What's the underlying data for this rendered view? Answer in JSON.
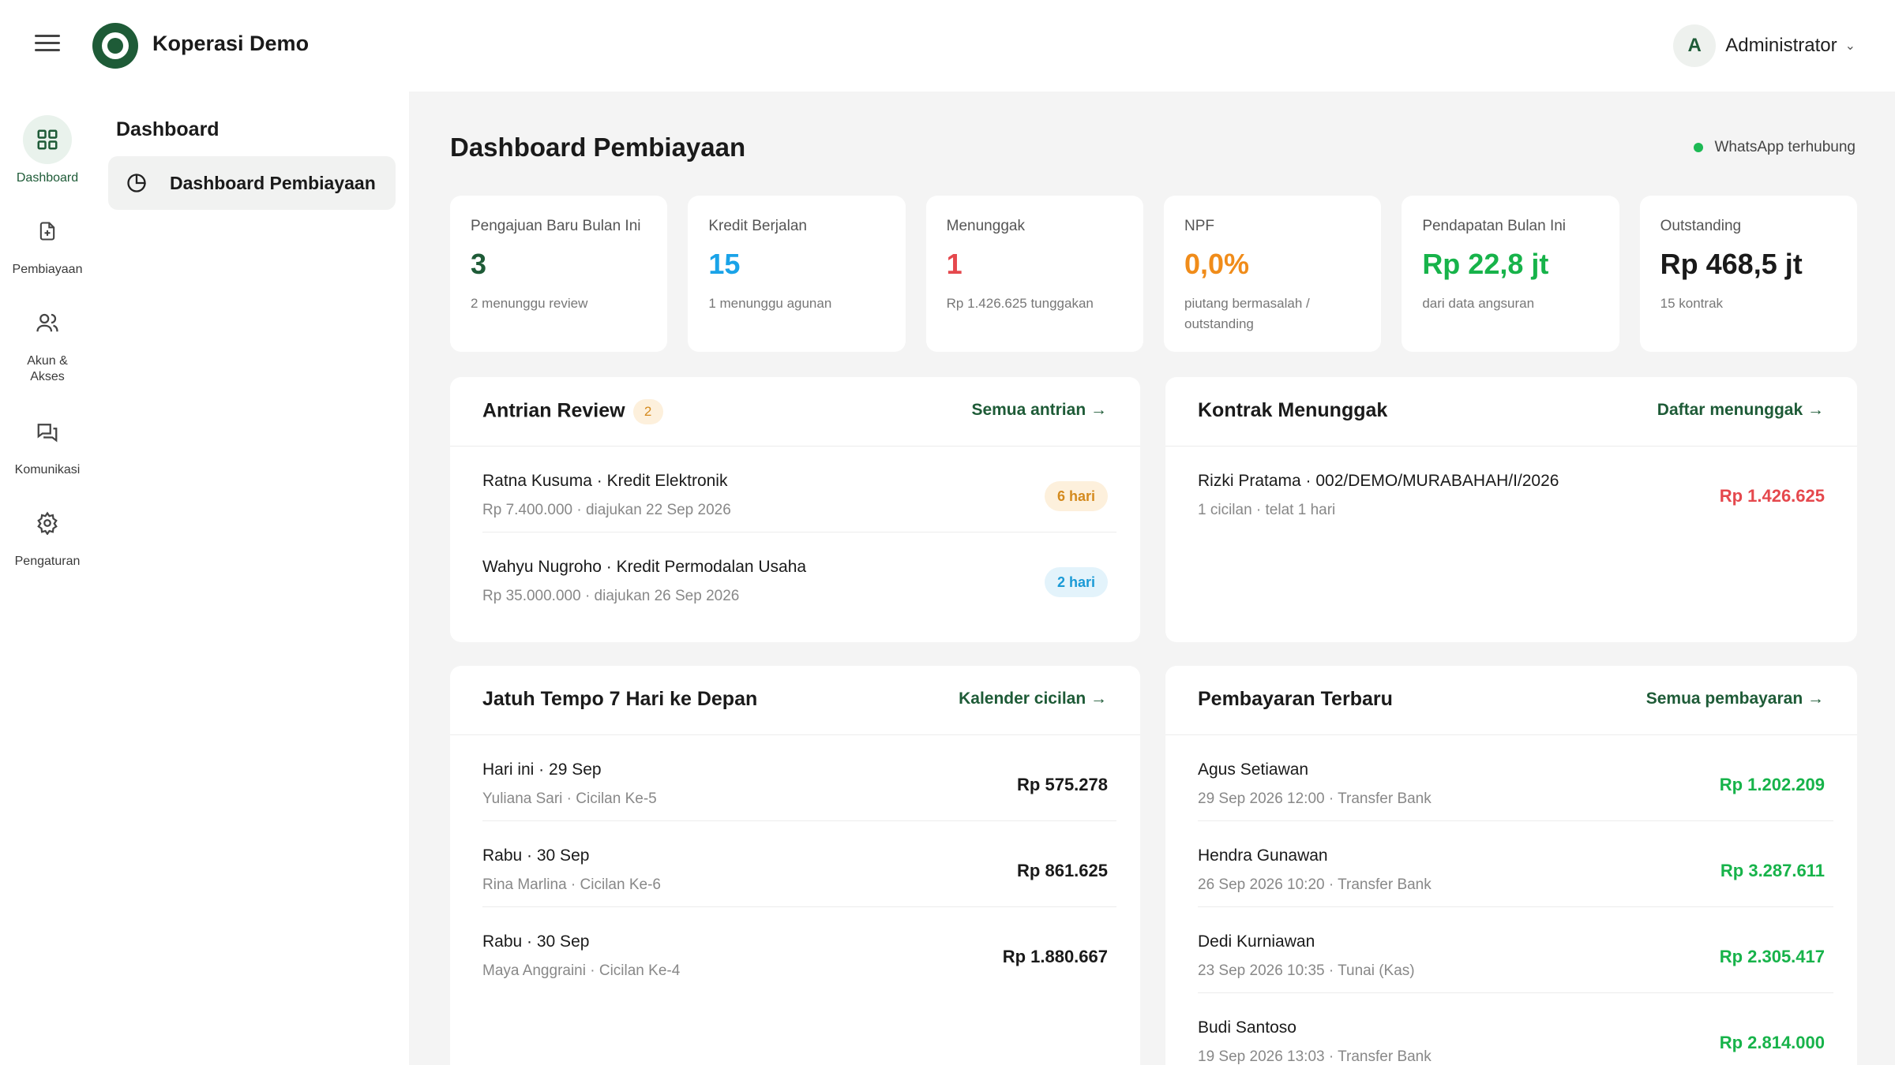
{
  "header": {
    "brand": "Koperasi Demo",
    "user_initial": "A",
    "user_name": "Administrator"
  },
  "rail": {
    "dashboard": "Dashboard",
    "pembiayaan": "Pembiayaan",
    "akun": "Akun & Akses",
    "komunikasi": "Komunikasi",
    "pengaturan": "Pengaturan"
  },
  "submenu": {
    "title": "Dashboard",
    "item": "Dashboard Pembiayaan"
  },
  "page": {
    "title": "Dashboard Pembiayaan",
    "wa_status": "WhatsApp terhubung"
  },
  "stats": [
    {
      "label": "Pengajuan Baru Bulan Ini",
      "value": "3",
      "sub": "2 menunggu review",
      "color": "#1e5b37"
    },
    {
      "label": "Kredit Berjalan",
      "value": "15",
      "sub": "1 menunggu agunan",
      "color": "#1aa3e8"
    },
    {
      "label": "Menunggak",
      "value": "1",
      "sub": "Rp 1.426.625 tunggakan",
      "color": "#e5484d"
    },
    {
      "label": "NPF",
      "value": "0,0%",
      "sub": "piutang bermasalah / outstanding",
      "color": "#f08c1a"
    },
    {
      "label": "Pendapatan Bulan Ini",
      "value": "Rp 22,8 jt",
      "sub": "dari data angsuran",
      "color": "#17b34a"
    },
    {
      "label": "Outstanding",
      "value": "Rp 468,5 jt",
      "sub": "15 kontrak",
      "color": "#1a1a1a"
    }
  ],
  "review": {
    "title": "Antrian Review",
    "count": "2",
    "link": "Semua antrian →",
    "rows": [
      {
        "title": "Ratna Kusuma · Kredit Elektronik",
        "sub": "Rp 7.400.000 · diajukan 22 Sep 2026",
        "badge": "6 hari"
      },
      {
        "title": "Wahyu Nugroho · Kredit Permodalan Usaha",
        "sub": "Rp 35.000.000 · diajukan 26 Sep 2026",
        "badge": "2 hari"
      }
    ]
  },
  "arrears": {
    "title": "Kontrak Menunggak",
    "link": "Daftar menunggak →",
    "rows": [
      {
        "title": "Rizki Pratama · 002/DEMO/MURABAHAH/I/2026",
        "sub": "1 cicilan · telat 1 hari",
        "amount": "Rp 1.426.625"
      }
    ]
  },
  "due": {
    "title": "Jatuh Tempo 7 Hari ke Depan",
    "link": "Kalender cicilan →",
    "rows": [
      {
        "title": "Hari ini · 29 Sep",
        "sub": "Yuliana Sari · Cicilan Ke-5",
        "amount": "Rp 575.278"
      },
      {
        "title": "Rabu · 30 Sep",
        "sub": "Rina Marlina · Cicilan Ke-6",
        "amount": "Rp 861.625"
      },
      {
        "title": "Rabu · 30 Sep",
        "sub": "Maya Anggraini · Cicilan Ke-4",
        "amount": "Rp 1.880.667"
      }
    ]
  },
  "payments": {
    "title": "Pembayaran Terbaru",
    "link": "Semua pembayaran →",
    "rows": [
      {
        "title": "Agus Setiawan",
        "sub": "29 Sep 2026 12:00 · Transfer Bank",
        "amount": "Rp 1.202.209"
      },
      {
        "title": "Hendra Gunawan",
        "sub": "26 Sep 2026 10:20 · Transfer Bank",
        "amount": "Rp 3.287.611"
      },
      {
        "title": "Dedi Kurniawan",
        "sub": "23 Sep 2026 10:35 · Tunai (Kas)",
        "amount": "Rp 2.305.417"
      },
      {
        "title": "Budi Santoso",
        "sub": "19 Sep 2026 13:03 · Transfer Bank",
        "amount": "Rp 2.814.000"
      }
    ]
  },
  "colors": {
    "brand": "#1e5b37",
    "danger": "#e5484d",
    "success": "#17b34a",
    "warning": "#d48a1e",
    "info": "#1a9ad6"
  }
}
